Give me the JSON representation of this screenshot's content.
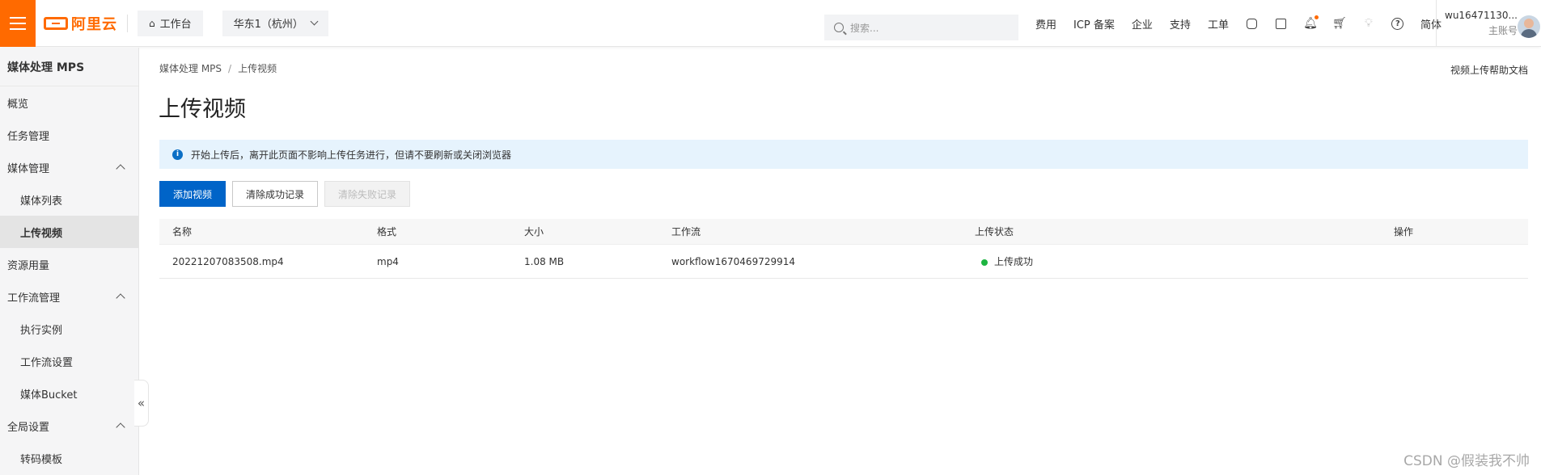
{
  "topbar": {
    "logo_text": "阿里云",
    "workbench": "工作台",
    "region": "华东1（杭州）",
    "search_placeholder": "搜索...",
    "nav": [
      "费用",
      "ICP 备案",
      "企业",
      "支持",
      "工单"
    ],
    "lang": "简体",
    "user_name": "wu16471130...",
    "user_role": "主账号"
  },
  "sidebar": {
    "title": "媒体处理 MPS",
    "items": [
      {
        "label": "概览"
      },
      {
        "label": "任务管理"
      },
      {
        "label": "媒体管理"
      },
      {
        "label": "媒体列表"
      },
      {
        "label": "上传视频"
      },
      {
        "label": "资源用量"
      },
      {
        "label": "工作流管理"
      },
      {
        "label": "执行实例"
      },
      {
        "label": "工作流设置"
      },
      {
        "label": "媒体Bucket"
      },
      {
        "label": "全局设置"
      },
      {
        "label": "转码模板"
      }
    ],
    "collapse_glyph": "«"
  },
  "main": {
    "breadcrumb": [
      "媒体处理 MPS",
      "上传视频"
    ],
    "breadcrumb_sep": "/",
    "help_link": "视频上传帮助文档",
    "title": "上传视频",
    "notice": "开始上传后，离开此页面不影响上传任务进行，但请不要刷新或关闭浏览器",
    "buttons": {
      "add": "添加视频",
      "clear_success": "清除成功记录",
      "clear_failed": "清除失败记录"
    },
    "table": {
      "columns": [
        "名称",
        "格式",
        "大小",
        "工作流",
        "上传状态",
        "操作"
      ],
      "rows": [
        {
          "name": "20221207083508.mp4",
          "format": "mp4",
          "size": "1.08 MB",
          "workflow": "workflow1670469729914",
          "status": "上传成功",
          "action": ""
        }
      ]
    }
  },
  "watermark": "CSDN @假装我不帅",
  "colors": {
    "brand": "#ff6a00",
    "primary": "#0064c8",
    "success": "#1db440",
    "notice_bg": "#e6f3fd"
  }
}
